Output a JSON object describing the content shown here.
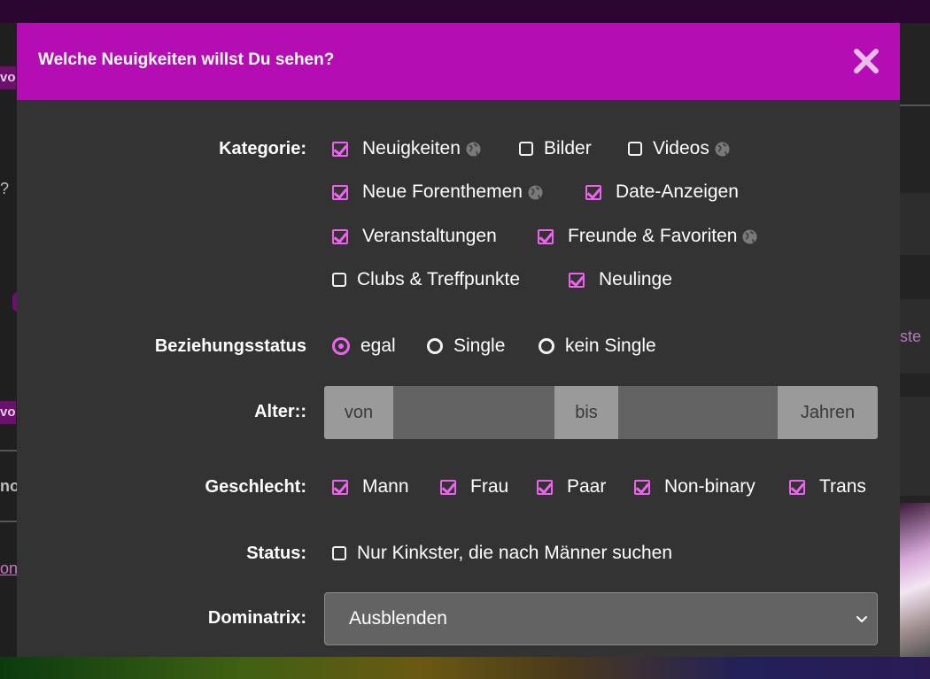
{
  "background": {
    "left_tags": [
      "vo",
      "vo"
    ],
    "left_texts": [
      "?",
      "no",
      "on"
    ],
    "right_texts": [
      "ste"
    ]
  },
  "modal": {
    "title": "Welche Neuigkeiten willst Du sehen?",
    "close_icon": "close-icon"
  },
  "kategorie": {
    "label": "Kategorie:",
    "options": [
      {
        "label": "Neuigkeiten",
        "checked": true,
        "public": true
      },
      {
        "label": "Bilder",
        "checked": false,
        "public": false
      },
      {
        "label": "Videos",
        "checked": false,
        "public": true
      },
      {
        "label": "Neue Forenthemen",
        "checked": true,
        "public": true
      },
      {
        "label": "Date-Anzeigen",
        "checked": true,
        "public": false
      },
      {
        "label": "Veranstaltungen",
        "checked": true,
        "public": false
      },
      {
        "label": "Freunde & Favoriten",
        "checked": true,
        "public": true
      },
      {
        "label": "Clubs & Treffpunkte",
        "checked": false,
        "public": false
      },
      {
        "label": "Neulinge",
        "checked": true,
        "public": false
      }
    ]
  },
  "beziehungsstatus": {
    "label": "Beziehungsstatus",
    "options": [
      {
        "label": "egal",
        "selected": true
      },
      {
        "label": "Single",
        "selected": false
      },
      {
        "label": "kein Single",
        "selected": false
      }
    ]
  },
  "alter": {
    "label": "Alter::",
    "from_label": "von",
    "to_label": "bis",
    "unit_label": "Jahren",
    "from_value": "",
    "to_value": ""
  },
  "geschlecht": {
    "label": "Geschlecht:",
    "options": [
      {
        "label": "Mann",
        "checked": true
      },
      {
        "label": "Frau",
        "checked": true
      },
      {
        "label": "Paar",
        "checked": true
      },
      {
        "label": "Non-binary",
        "checked": true
      },
      {
        "label": "Trans",
        "checked": true
      }
    ]
  },
  "status": {
    "label": "Status:",
    "option": {
      "label": "Nur Kinkster, die nach Männer suchen",
      "checked": false
    }
  },
  "dominatrix": {
    "label": "Dominatrix:",
    "selected": "Ausblenden"
  },
  "colors": {
    "accent": "#b40db4",
    "check": "#ef62ef",
    "modal_bg": "#333333"
  }
}
